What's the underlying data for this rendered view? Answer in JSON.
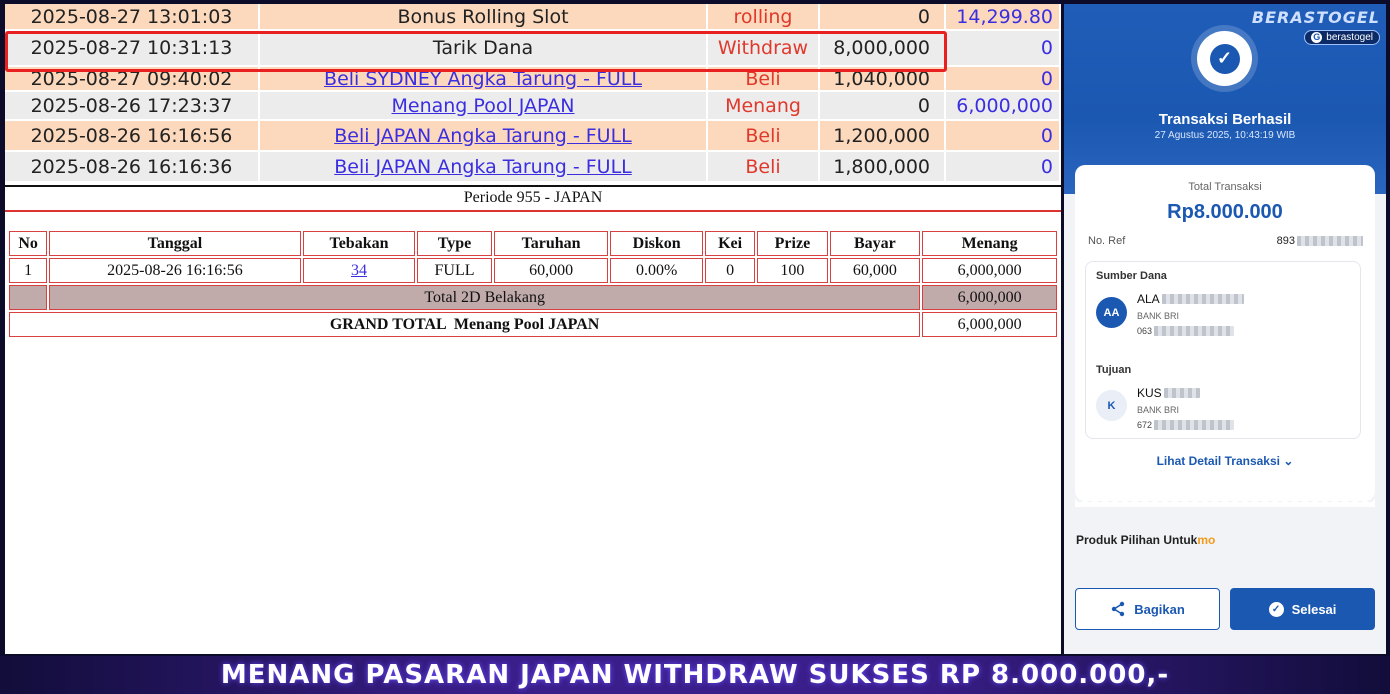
{
  "transactions": [
    {
      "date": "2025-08-27 13:01:03",
      "desc": "Bonus Rolling Slot",
      "type": "rolling",
      "amount": "0",
      "balance": "14,299.80",
      "link": false
    },
    {
      "date": "2025-08-27 10:31:13",
      "desc": "Tarik Dana",
      "type": "Withdraw",
      "amount": "8,000,000",
      "balance": "0",
      "link": false
    },
    {
      "date": "2025-08-27 09:40:02",
      "desc": "Beli SYDNEY Angka Tarung - FULL",
      "type": "Beli",
      "amount": "1,040,000",
      "balance": "0",
      "link": true
    },
    {
      "date": "2025-08-26 17:23:37",
      "desc": "Menang Pool JAPAN",
      "type": "Menang",
      "amount": "0",
      "balance": "6,000,000",
      "link": true
    },
    {
      "date": "2025-08-26 16:16:56",
      "desc": "Beli JAPAN Angka Tarung - FULL",
      "type": "Beli",
      "amount": "1,200,000",
      "balance": "0",
      "link": true
    },
    {
      "date": "2025-08-26 16:16:36",
      "desc": "Beli JAPAN Angka Tarung - FULL",
      "type": "Beli",
      "amount": "1,800,000",
      "balance": "0",
      "link": true
    }
  ],
  "periode": "Periode 955 - JAPAN",
  "result_table": {
    "headers": [
      "No",
      "Tanggal",
      "Tebakan",
      "Type",
      "Taruhan",
      "Diskon",
      "Kei",
      "Prize",
      "Bayar",
      "Menang"
    ],
    "row": [
      "1",
      "2025-08-26 16:16:56",
      "34",
      "FULL",
      "60,000",
      "0.00%",
      "0",
      "100",
      "60,000",
      "6,000,000"
    ],
    "subtotal_label": "Total 2D Belakang",
    "subtotal_value": "6,000,000",
    "grand_label": "GRAND TOTAL  Menang Pool JAPAN",
    "grand_value": "6,000,000"
  },
  "receipt": {
    "brand_name": "BERASTOGEL",
    "brand_pill": "berastogel",
    "title": "Transaksi Berhasil",
    "datetime": "27 Agustus 2025, 10:43:19 WIB",
    "total_label": "Total Transaksi",
    "total_amount": "Rp8.000.000",
    "ref_label": "No. Ref",
    "ref_value": "893",
    "source_label": "Sumber Dana",
    "source_initials": "AA",
    "source_name": "ALA",
    "source_bank": "BANK BRI",
    "source_account": "063",
    "dest_label": "Tujuan",
    "dest_initials": "K",
    "dest_name": "KUS",
    "dest_bank": "BANK BRI",
    "dest_account": "672",
    "detail_link": "Lihat Detail Transaksi",
    "produk_label": "Produk Pilihan Untuk",
    "produk_suffix": "mo",
    "share_label": "Bagikan",
    "done_label": "Selesai"
  },
  "banner": "MENANG PASARAN JAPAN WITHDRAW SUKSES RP 8.000.000,-",
  "colors": {
    "accent": "#1b58b2",
    "danger": "#e0392b",
    "link": "#3a2ee0",
    "peach": "#fcd9bd"
  }
}
